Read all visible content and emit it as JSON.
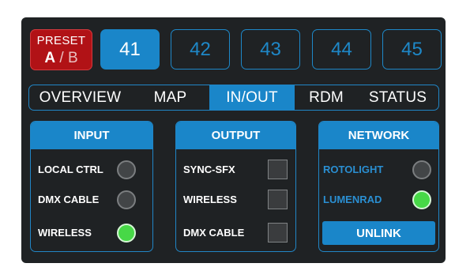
{
  "preset": {
    "title": "PRESET",
    "a": "A",
    "separator": " / ",
    "b": "B"
  },
  "slots": [
    "41",
    "42",
    "43",
    "44",
    "45"
  ],
  "tabs": [
    "OVERVIEW",
    "MAP",
    "IN/OUT",
    "RDM",
    "STATUS"
  ],
  "active_tab": "IN/OUT",
  "input": {
    "title": "INPUT",
    "rows": [
      {
        "label": "LOCAL CTRL",
        "indicator": "off"
      },
      {
        "label": "DMX CABLE",
        "indicator": "off"
      },
      {
        "label": "WIRELESS",
        "indicator": "on"
      }
    ]
  },
  "output": {
    "title": "OUTPUT",
    "rows": [
      {
        "label": "SYNC-SFX",
        "checked": false
      },
      {
        "label": "WIRELESS",
        "checked": false
      },
      {
        "label": "DMX CABLE",
        "checked": false
      }
    ]
  },
  "network": {
    "title": "NETWORK",
    "rows": [
      {
        "label": "ROTOLIGHT",
        "indicator": "off"
      },
      {
        "label": "LUMENRAD",
        "indicator": "on"
      }
    ],
    "unlink_label": "UNLINK"
  },
  "colors": {
    "accent": "#1a86c9",
    "preset_red": "#b11216",
    "led_on": "#47d847",
    "background": "#1f2224"
  }
}
